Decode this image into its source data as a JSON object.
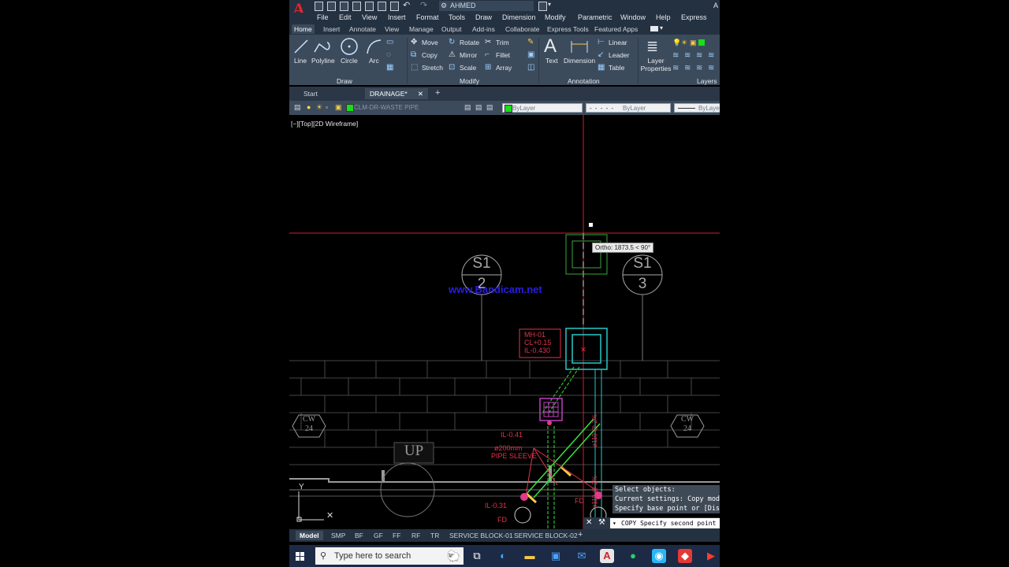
{
  "title_bar": {
    "workspace": "AHMED",
    "user": "A"
  },
  "menu": [
    "File",
    "Edit",
    "View",
    "Insert",
    "Format",
    "Tools",
    "Draw",
    "Dimension",
    "Modify",
    "Parametric",
    "Window",
    "Help",
    "Express"
  ],
  "ribbon_tabs": [
    "Home",
    "Insert",
    "Annotate",
    "View",
    "Manage",
    "Output",
    "Add-ins",
    "Collaborate",
    "Express Tools",
    "Featured Apps"
  ],
  "draw_panel": {
    "name": "Draw",
    "tools": [
      "Line",
      "Polyline",
      "Circle",
      "Arc"
    ]
  },
  "modify_panel": {
    "name": "Modify",
    "tools": [
      "Move",
      "Rotate",
      "Trim",
      "Copy",
      "Mirror",
      "Fillet",
      "Stretch",
      "Scale",
      "Array"
    ]
  },
  "annotation_panel": {
    "name": "Annotation",
    "tools": [
      "Text",
      "Dimension",
      "Linear",
      "Leader",
      "Table"
    ]
  },
  "layers_panel": {
    "name": "Layers",
    "layer_properties": "Layer Properties"
  },
  "file_tabs": [
    "Start",
    "DRAINAGE*"
  ],
  "layer_bar": {
    "current_layer": "CLM-DR-WASTE PIPE",
    "color": "ByLayer",
    "linetype": "ByLayer",
    "lineweight": "ByLayer"
  },
  "viewport_label": "[−][Top][2D Wireframe]",
  "tooltip": "Ortho: 1873.5 < 90°",
  "watermark": "www.Bandicam.net",
  "drawing_labels": {
    "s1_2_top": "S1",
    "s1_2_bottom": "2",
    "s1_3_top": "S1",
    "s1_3_bottom": "3",
    "mh_1": "MH-01",
    "mh_2": "CL+0.15",
    "mh_3": "IL-0.430",
    "il_041": "IL-0.41",
    "sleeve_1": "ø200mm",
    "sleeve_2": "PIPE SLEEVE",
    "il_031": "IL-0.31",
    "fd_1": "FD",
    "fd_2": "FD",
    "cw_left_top": "CW",
    "cw_left_bottom": "24",
    "cw_right_top": "CW",
    "cw_right_bottom": "24",
    "up": "UP",
    "dia_1": "ø110 @ 2%",
    "dia_2": "ø110 @ 2%"
  },
  "command_history": [
    "Select objects:",
    "Current settings:  Copy mode = Multiple",
    "Specify base point or [Displacement/mOde] <Displacement>:"
  ],
  "command_prompt": "COPY Specify second point",
  "layout_tabs": [
    "Model",
    "SMP",
    "BF",
    "GF",
    "FF",
    "RF",
    "TR",
    "SERVICE BLOCK-01",
    "SERVICE BLOCK-02"
  ],
  "taskbar": {
    "search_placeholder": "Type here to search"
  },
  "colors": {
    "drawing_bg": "#000000",
    "crosshair": "#d0202a",
    "pipe_green": "#39e13a",
    "cyan": "#27c9c9",
    "magenta": "#e23a8c",
    "red_text": "#e0334a"
  }
}
